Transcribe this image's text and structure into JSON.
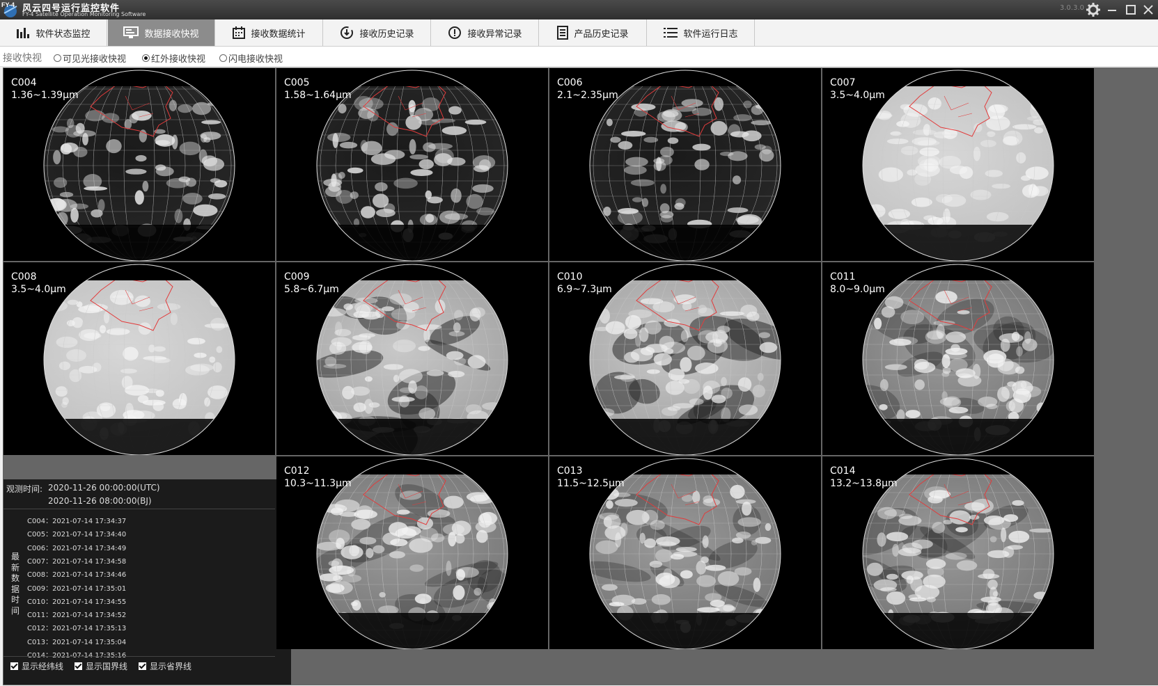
{
  "app": {
    "logo_text": "FY-4",
    "title_cn": "风云四号运行监控软件",
    "title_en": "FY-4 Satellite Operation Monitoring Software",
    "version": "3.0.3.0"
  },
  "tabs": [
    {
      "label": "软件状态监控",
      "icon": "bar-chart-icon",
      "active": false
    },
    {
      "label": "数据接收快视",
      "icon": "monitor-icon",
      "active": true
    },
    {
      "label": "接收数据统计",
      "icon": "calendar-icon",
      "active": false
    },
    {
      "label": "接收历史记录",
      "icon": "history-icon",
      "active": false
    },
    {
      "label": "接收异常记录",
      "icon": "alert-icon",
      "active": false
    },
    {
      "label": "产品历史记录",
      "icon": "document-icon",
      "active": false
    },
    {
      "label": "软件运行日志",
      "icon": "list-icon",
      "active": false
    }
  ],
  "subbar": {
    "label": "接收快视",
    "options": [
      {
        "label": "可见光接收快视",
        "selected": false
      },
      {
        "label": "红外接收快视",
        "selected": true
      },
      {
        "label": "闪电接收快视",
        "selected": false
      }
    ]
  },
  "channels": [
    {
      "id": "C004",
      "band": "1.36~1.39µm",
      "style": "dark-vis"
    },
    {
      "id": "C005",
      "band": "1.58~1.64µm",
      "style": "dark-vis"
    },
    {
      "id": "C006",
      "band": "2.1~2.35µm",
      "style": "dark-vis"
    },
    {
      "id": "C007",
      "band": "3.5~4.0µm",
      "style": "ir-light"
    },
    {
      "id": "C008",
      "band": "3.5~4.0µm",
      "style": "ir-light"
    },
    {
      "id": "C009",
      "band": "5.8~6.7µm",
      "style": "water-vapor"
    },
    {
      "id": "C010",
      "band": "6.9~7.3µm",
      "style": "water-vapor"
    },
    {
      "id": "C011",
      "band": "8.0~9.0µm",
      "style": "ir"
    },
    {
      "id": "C012",
      "band": "10.3~11.3µm",
      "style": "ir"
    },
    {
      "id": "C013",
      "band": "11.5~12.5µm",
      "style": "ir"
    },
    {
      "id": "C014",
      "band": "13.2~13.8µm",
      "style": "ir"
    }
  ],
  "info": {
    "obs_label": "观测时间:",
    "obs_utc": "2020-11-26 00:00:00(UTC)",
    "obs_bj": "2020-11-26 08:00:00(BJ)",
    "latest_label": "最新数据时间",
    "latest_times": [
      "C004：2021-07-14 17:34:37",
      "C005：2021-07-14 17:34:40",
      "C006：2021-07-14 17:34:49",
      "C007：2021-07-14 17:34:58",
      "C008：2021-07-14 17:34:46",
      "C009：2021-07-14 17:35:01",
      "C010：2021-07-14 17:34:55",
      "C011：2021-07-14 17:34:52",
      "C012：2021-07-14 17:35:13",
      "C013：2021-07-14 17:35:04",
      "C014：2021-07-14 17:35:16"
    ],
    "checkboxes": [
      {
        "label": "显示经纬线",
        "checked": true
      },
      {
        "label": "显示国界线",
        "checked": true
      },
      {
        "label": "显示省界线",
        "checked": true
      }
    ]
  },
  "colors": {
    "accent_active_tab": "#8c8c8c",
    "border_line": "#e23b3b"
  }
}
